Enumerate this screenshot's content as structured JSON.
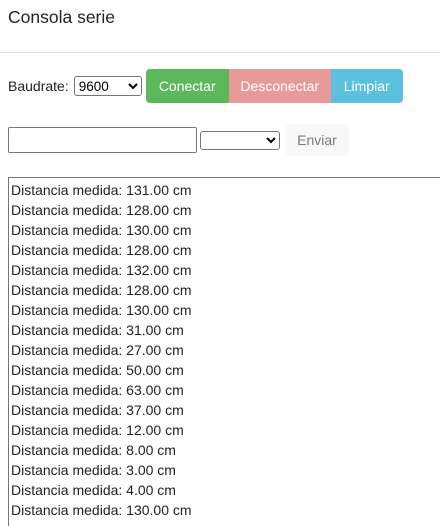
{
  "header": {
    "title": "Consola serie"
  },
  "toolbar": {
    "baud_label": "Baudrate:",
    "baud_selected": "9600",
    "connect_label": "Conectar",
    "disconnect_label": "Desconectar",
    "clear_label": "Limpiar"
  },
  "send": {
    "input_value": "",
    "line_ending_selected": "",
    "send_label": "Enviar"
  },
  "colors": {
    "connect": "#5cb85c",
    "disconnect": "#e89a9a",
    "clear": "#5bc0de",
    "send_bg": "#f8f8f8"
  },
  "console": {
    "lines": [
      "Distancia medida: 131.00 cm",
      "Distancia medida: 128.00 cm",
      "Distancia medida: 130.00 cm",
      "Distancia medida: 128.00 cm",
      "Distancia medida: 132.00 cm",
      "Distancia medida: 128.00 cm",
      "Distancia medida: 130.00 cm",
      "Distancia medida: 31.00 cm",
      "Distancia medida: 27.00 cm",
      "Distancia medida: 50.00 cm",
      "Distancia medida: 63.00 cm",
      "Distancia medida: 37.00 cm",
      "Distancia medida: 12.00 cm",
      "Distancia medida: 8.00 cm",
      "Distancia medida: 3.00 cm",
      "Distancia medida: 4.00 cm",
      "Distancia medida: 130.00 cm"
    ]
  }
}
